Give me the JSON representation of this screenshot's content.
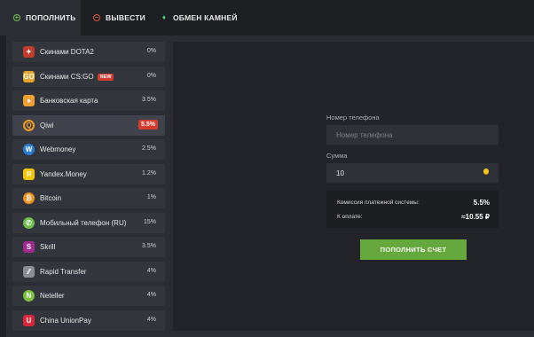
{
  "tabs": [
    {
      "label": "ПОПОЛНИТЬ",
      "icon": "plus-circle-icon",
      "color": "#6cc24a",
      "active": true
    },
    {
      "label": "ВЫВЕСТИ",
      "icon": "minus-circle-icon",
      "color": "#e05040",
      "active": false
    },
    {
      "label": "ОБМЕН КАМНЕЙ",
      "icon": "gem-icon",
      "color": "#4cd27a",
      "active": false
    }
  ],
  "methods": [
    {
      "label": "Скинами DOTA2",
      "fee": "0%",
      "icon": "dota2-icon",
      "color": "#c23c2a",
      "glyph": "✦"
    },
    {
      "label": "Скинами CS:GO",
      "fee": "0%",
      "badge": "NEW",
      "icon": "csgo-icon",
      "color": "#e0a52a",
      "glyph": "GO"
    },
    {
      "label": "Банковская карта",
      "fee": "3.5%",
      "icon": "bank-card-icon",
      "color": "#f0a030",
      "glyph": "●"
    },
    {
      "label": "Qiwi",
      "fee": "5.5%",
      "active": true,
      "icon": "qiwi-icon",
      "color": "#f39c1f",
      "glyph": "Q"
    },
    {
      "label": "Webmoney",
      "fee": "2.5%",
      "icon": "webmoney-icon",
      "color": "#2b7bd6",
      "glyph": "W"
    },
    {
      "label": "Yandex.Money",
      "fee": "1.2%",
      "icon": "yandex-money-icon",
      "color": "#f4c400",
      "glyph": "Я"
    },
    {
      "label": "Bitcoin",
      "fee": "1%",
      "icon": "bitcoin-icon",
      "color": "#f39321",
      "glyph": "₿"
    },
    {
      "label": "Мобильный телефон (RU)",
      "fee": "15%",
      "icon": "mobile-phone-icon",
      "color": "#6cc04a",
      "glyph": "✆"
    },
    {
      "label": "Skrill",
      "fee": "3.5%",
      "icon": "skrill-icon",
      "color": "#a02a8f",
      "glyph": "S"
    },
    {
      "label": "Rapid Transfer",
      "fee": "4%",
      "icon": "rapid-transfer-icon",
      "color": "#8a8d94",
      "glyph": "⁄⁄"
    },
    {
      "label": "Neteller",
      "fee": "4%",
      "icon": "neteller-icon",
      "color": "#7cc13a",
      "glyph": "N"
    },
    {
      "label": "China UnionPay",
      "fee": "4%",
      "icon": "unionpay-icon",
      "color": "#d8283a",
      "glyph": "U"
    }
  ],
  "form": {
    "phone_label": "Номер телефона",
    "phone_placeholder": "Номер телефона",
    "phone_value": "",
    "amount_label": "Сумма",
    "amount_value": "10",
    "commission_label": "Комиссия платежной системы:",
    "commission_value": "5.5%",
    "total_label": "К оплате:",
    "total_value": "≈10.55 ₽",
    "submit_label": "ПОПОЛНИТЬ СЧЕТ"
  },
  "colors": {
    "accent_green": "#65a83c",
    "fee_highlight": "#d63b2f"
  }
}
